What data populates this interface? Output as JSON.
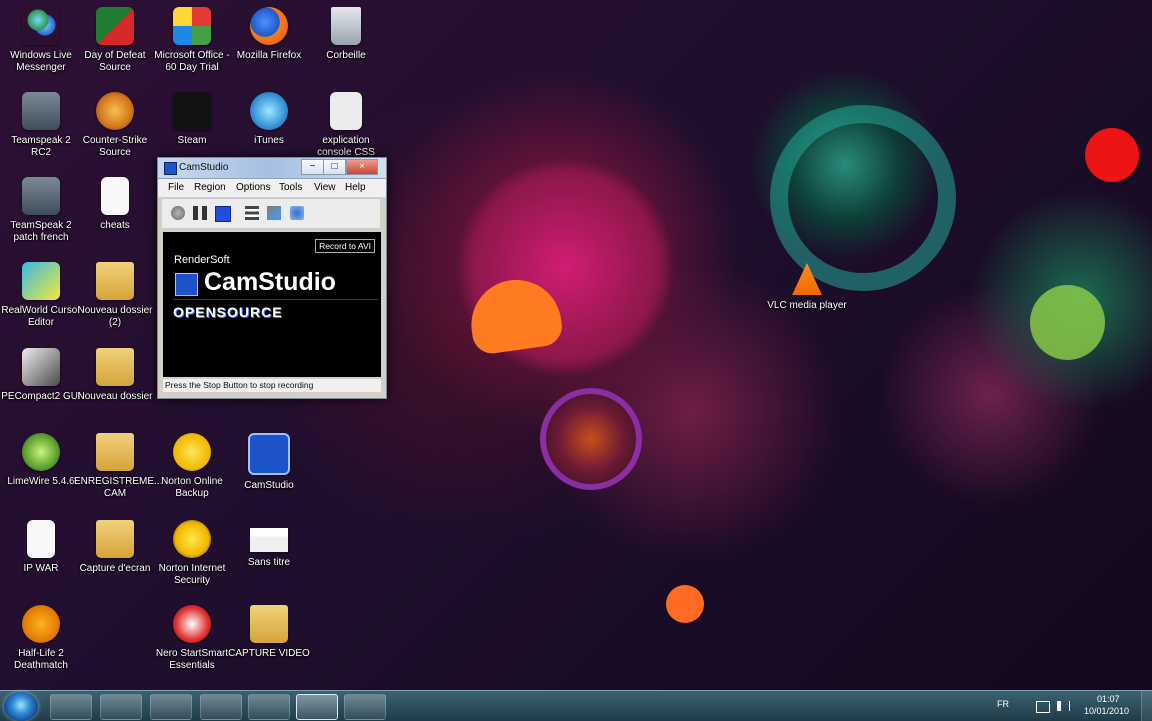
{
  "desktop": {
    "icons": [
      {
        "id": "windows-live-messenger",
        "label": "Windows Live Messenger"
      },
      {
        "id": "day-of-defeat-source",
        "label": "Day of Defeat Source"
      },
      {
        "id": "microsoft-office",
        "label": "Microsoft Office - 60 Day Trial"
      },
      {
        "id": "mozilla-firefox",
        "label": "Mozilla Firefox"
      },
      {
        "id": "corbeille",
        "label": "Corbeille"
      },
      {
        "id": "teamspeak-2-rc2",
        "label": "Teamspeak 2 RC2"
      },
      {
        "id": "counter-strike-source",
        "label": "Counter-Strike Source"
      },
      {
        "id": "steam",
        "label": "Steam"
      },
      {
        "id": "itunes",
        "label": "iTunes"
      },
      {
        "id": "explication-console-css",
        "label": "explication console CSS"
      },
      {
        "id": "teamspeak-2-patch-french",
        "label": "TeamSpeak 2 patch french"
      },
      {
        "id": "cheats",
        "label": "cheats"
      },
      {
        "id": "realworld-cursor-editor",
        "label": "RealWorld Cursor Editor"
      },
      {
        "id": "nouveau-dossier-2",
        "label": "Nouveau dossier (2)"
      },
      {
        "id": "vlc-media-player",
        "label": "VLC media player"
      },
      {
        "id": "pecompact2-gui",
        "label": "PECompact2 GUI"
      },
      {
        "id": "nouveau-dossier",
        "label": "Nouveau dossier"
      },
      {
        "id": "limewire",
        "label": "LimeWire 5.4.6"
      },
      {
        "id": "enregistreme-cam",
        "label": "ENREGISTREME... CAM"
      },
      {
        "id": "norton-online-backup",
        "label": "Norton Online Backup"
      },
      {
        "id": "camstudio",
        "label": "CamStudio"
      },
      {
        "id": "ip-war",
        "label": "IP WAR"
      },
      {
        "id": "capture-decran",
        "label": "Capture d'ecran"
      },
      {
        "id": "norton-internet-security",
        "label": "Norton Internet Security"
      },
      {
        "id": "sans-titre",
        "label": "Sans titre"
      },
      {
        "id": "half-life-2-deathmatch",
        "label": "Half-Life 2 Deathmatch"
      },
      {
        "id": "nero-startsmart",
        "label": "Nero StartSmart Essentials"
      },
      {
        "id": "capture-video",
        "label": "CAPTURE VIDEO"
      }
    ]
  },
  "camstudio_window": {
    "title": "CamStudio",
    "menu": [
      "File",
      "Region",
      "Options",
      "Tools",
      "View",
      "Help"
    ],
    "record_mode": "Record to AVI",
    "brand_top": "RenderSoft",
    "brand_main": "CamStudio",
    "brand_sub": "OPENSOURCE",
    "status": "Press the Stop Button to stop recording"
  },
  "taskbar": {
    "language": "FR",
    "time": "01:07",
    "date": "10/01/2010"
  },
  "colors": {
    "camstudio_blue": "#1c53c8",
    "taskbar": "#2f5565"
  }
}
